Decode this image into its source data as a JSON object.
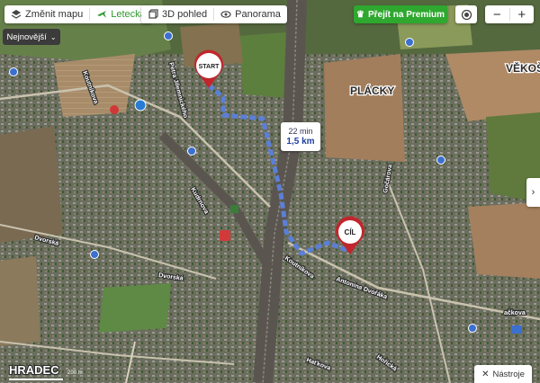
{
  "toolbar": {
    "change_map_label": "Změnit mapu",
    "aerial_label": "Letecká",
    "view3d_label": "3D pohled",
    "panorama_label": "Panorama",
    "premium_label": "Přejít na Premium",
    "zoom_in": "+",
    "zoom_out": "−"
  },
  "sort": {
    "label": "Nejnovější"
  },
  "route": {
    "start_label": "START",
    "end_label": "CÍL",
    "duration": "22 min",
    "distance": "1,5 km",
    "color": "#5b7fd6"
  },
  "places": {
    "placky": "PLÁCKY",
    "vekos": "VĚKOŠ",
    "hradec": "HRADEC"
  },
  "streets": {
    "koutna": "Koutníkova",
    "petra": "Petra Jilemnického",
    "kudrnova": "Kudrnova",
    "dvorska1": "Dvorská",
    "dvorska2": "Dvorská",
    "koutna2": "Koutníkova",
    "antonina": "Antonína Dvořáka",
    "vackova": "ačkova",
    "hatkova": "Haťkova",
    "hodinova": "Hořická",
    "zelezova": "Gočárova"
  },
  "tools": {
    "label": "Nástroje"
  },
  "scale": {
    "label": "200 m"
  },
  "colors": {
    "premium": "#2fa82f",
    "accent_green": "#2e9a2e"
  }
}
